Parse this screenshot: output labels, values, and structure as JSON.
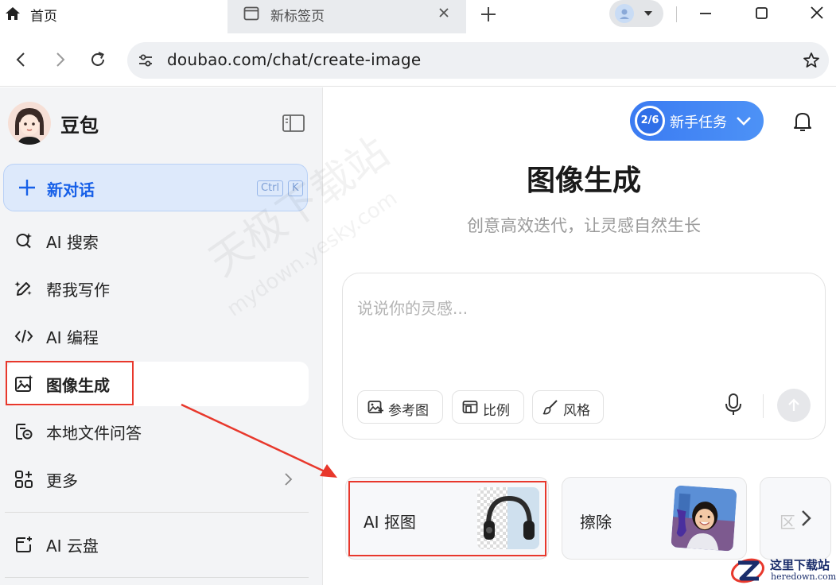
{
  "browser": {
    "active_tab": {
      "title": "首页",
      "icon": "home-icon"
    },
    "inactive_tab": {
      "title": "新标签页",
      "icon": "tab-page-icon"
    },
    "url": "doubao.com/chat/create-image"
  },
  "sidebar": {
    "brand": "豆包",
    "new_chat": {
      "label": "新对话",
      "kbd_ctrl": "Ctrl",
      "kbd_k": "K"
    },
    "items": [
      {
        "label": "AI 搜索",
        "icon": "ai-search-icon"
      },
      {
        "label": "帮我写作",
        "icon": "pen-sparkle-icon"
      },
      {
        "label": "AI 编程",
        "icon": "code-icon"
      },
      {
        "label": "图像生成",
        "icon": "image-gen-icon",
        "active": true
      },
      {
        "label": "本地文件问答",
        "icon": "file-chat-icon"
      },
      {
        "label": "更多",
        "icon": "grid-plus-icon"
      },
      {
        "label": "AI 云盘",
        "icon": "cloud-drive-icon"
      }
    ]
  },
  "main": {
    "task": {
      "progress": "2/6",
      "label": "新手任务"
    },
    "title": "图像生成",
    "subtitle": "创意高效迭代，让灵感自然生长",
    "composer": {
      "placeholder": "说说你的灵感...",
      "chips": [
        {
          "label": "参考图",
          "icon": "image-ref-icon"
        },
        {
          "label": "比例",
          "icon": "ratio-icon"
        },
        {
          "label": "风格",
          "icon": "brush-icon"
        }
      ]
    },
    "tools": [
      {
        "label": "AI 抠图"
      },
      {
        "label": "擦除"
      },
      {
        "label": "区"
      }
    ]
  },
  "watermark": {
    "text": "天极下载站",
    "url": "mydown.yesky.com"
  },
  "corner_logo": {
    "name": "这里下载站",
    "site": "heredown.com"
  },
  "colors": {
    "accent": "#1760e8",
    "highlight": "#e8382c",
    "sidebar_bg": "#f3f4f6"
  }
}
